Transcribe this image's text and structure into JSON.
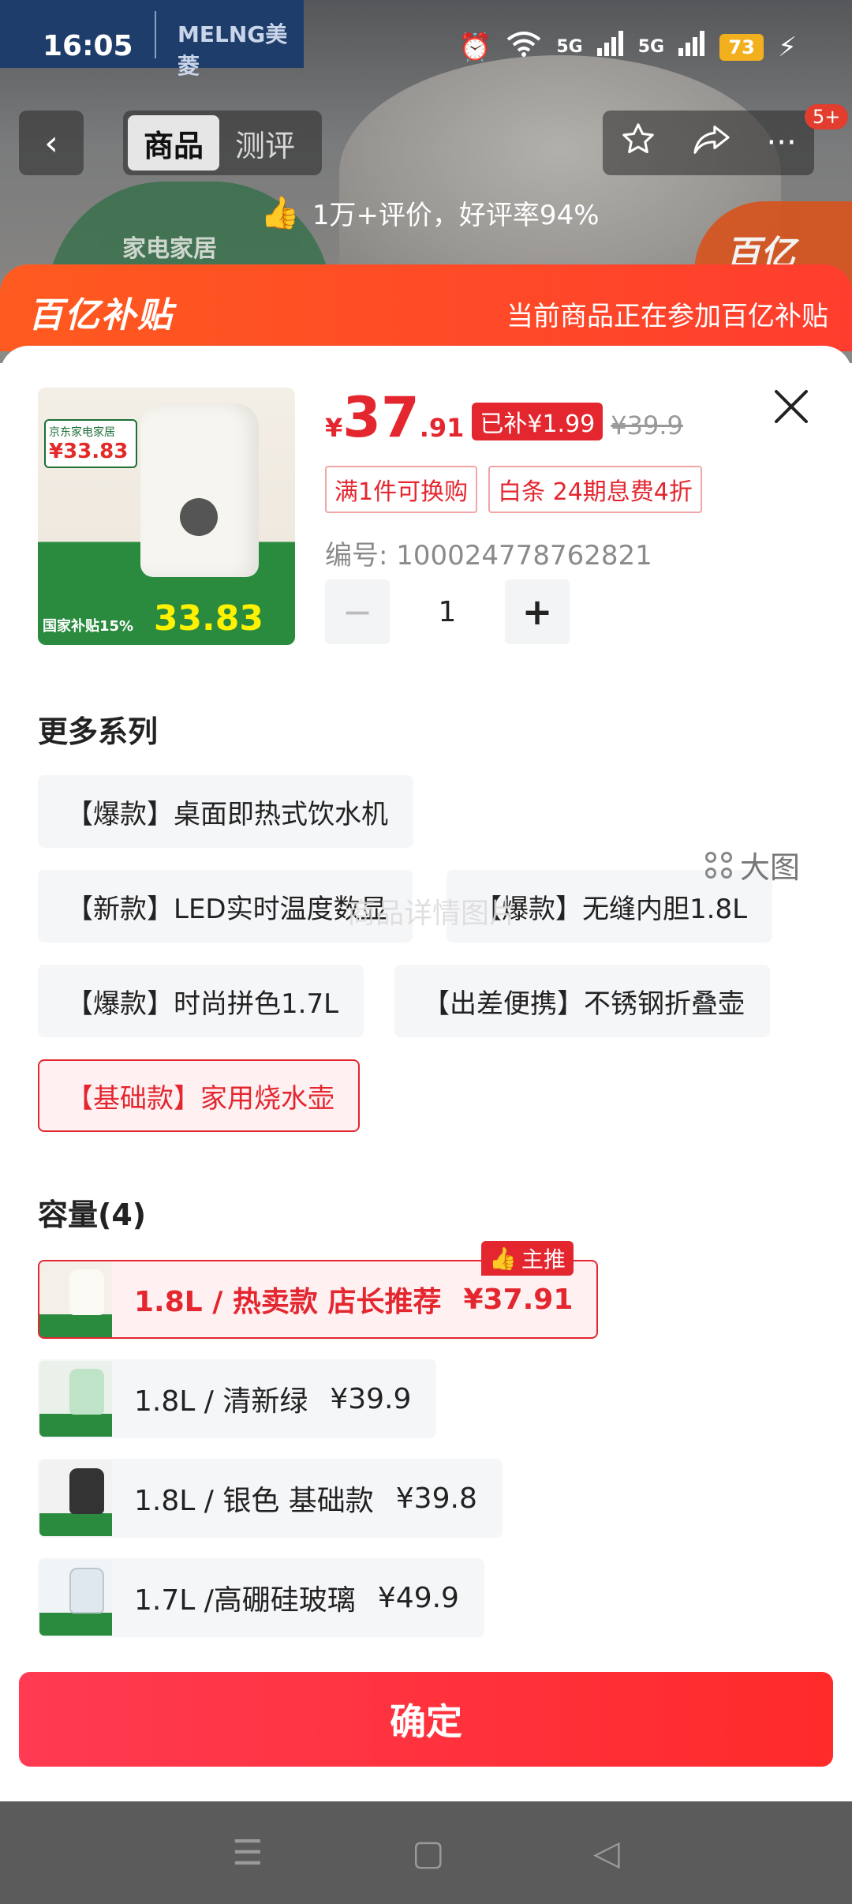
{
  "status_bar": {
    "time": "16:05",
    "brand": "MELNG美菱",
    "network_1": "5G",
    "network_2": "5G",
    "battery": "73"
  },
  "nav": {
    "tabs": [
      {
        "label": "商品",
        "active": true
      },
      {
        "label": "测评",
        "active": false
      }
    ],
    "notification_badge": "5+",
    "review_summary": "1万+评价，好评率94%"
  },
  "background": {
    "green_label": "家电家居",
    "corner_logo": "百亿"
  },
  "subsidy_banner": {
    "logo": "百亿补贴",
    "message": "当前商品正在参加百亿补贴"
  },
  "product": {
    "thumb_text": {
      "tag_title": "京东家电家居",
      "tag_price": "¥33.83",
      "bottom": "国家补贴15%",
      "big_price": "33.83"
    },
    "price_symbol": "¥",
    "price_int": "37",
    "price_dec": ".91",
    "subsidy": "已补¥1.99",
    "original_price": "¥39.9",
    "promo_tags": [
      "满1件可换购",
      "白条 24期息费4折"
    ],
    "sku_code": "编号: 100024778762821",
    "quantity": "1"
  },
  "series": {
    "title": "更多系列",
    "watermark": "商品详情图片",
    "options": [
      {
        "label": "【爆款】桌面即热式饮水机",
        "selected": false
      },
      {
        "label": "【新款】LED实时温度数显",
        "selected": false
      },
      {
        "label": "【爆款】无缝内胆1.8L",
        "selected": false
      },
      {
        "label": "【爆款】时尚拼色1.7L",
        "selected": false
      },
      {
        "label": "【出差便携】不锈钢折叠壶",
        "selected": false
      },
      {
        "label": "【基础款】家用烧水壶",
        "selected": true
      }
    ]
  },
  "capacity": {
    "title": "容量(4)",
    "big_view_label": "大图",
    "recommend_badge": "主推",
    "options": [
      {
        "label": "1.8L / 热卖款 店长推荐",
        "price": "¥37.91",
        "selected": true
      },
      {
        "label": "1.8L / 清新绿",
        "price": "¥39.9",
        "selected": false
      },
      {
        "label": "1.8L / 银色 基础款",
        "price": "¥39.8",
        "selected": false
      },
      {
        "label": "1.7L /高硼硅玻璃",
        "price": "¥49.9",
        "selected": false
      }
    ]
  },
  "confirm_label": "确定",
  "icons": {
    "back": "chevron-left-icon",
    "favorite": "star-icon",
    "share": "share-icon",
    "more": "more-icon",
    "close": "close-icon",
    "thumb": "thumbs-up-icon",
    "grid": "grid-icon"
  },
  "colors": {
    "accent": "#e4262f",
    "banner": "#ff4a24",
    "confirm": "#ff3042"
  }
}
